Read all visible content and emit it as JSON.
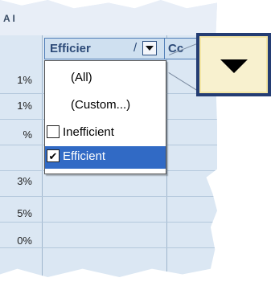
{
  "sheet": {
    "top_fragment": "A I",
    "row_labels": [
      "1%",
      "1%",
      "%",
      "3%",
      "5%",
      "0%"
    ],
    "column_header": "Efficier",
    "column_header_sort_glyph": "/",
    "next_column_header": "Cc"
  },
  "dropdown": {
    "items": [
      {
        "label": "(All)",
        "checkbox": false,
        "checked": false,
        "selected": false
      },
      {
        "label": "(Custom...)",
        "checkbox": false,
        "checked": false,
        "selected": false
      },
      {
        "label": "Inefficient",
        "checkbox": true,
        "checked": false,
        "selected": false
      },
      {
        "label": "Efficient",
        "checkbox": true,
        "checked": true,
        "selected": true
      }
    ]
  },
  "icons": {
    "filter_dropdown": "chevron-down-icon",
    "zoom_callout": "zoom-dropdown-arrow-icon",
    "check": "checkmark-icon"
  },
  "colors": {
    "selection": "#316ac5",
    "header_text": "#2c4a78",
    "zoom_border": "#243d73",
    "zoom_fill": "#f8f1cf"
  }
}
